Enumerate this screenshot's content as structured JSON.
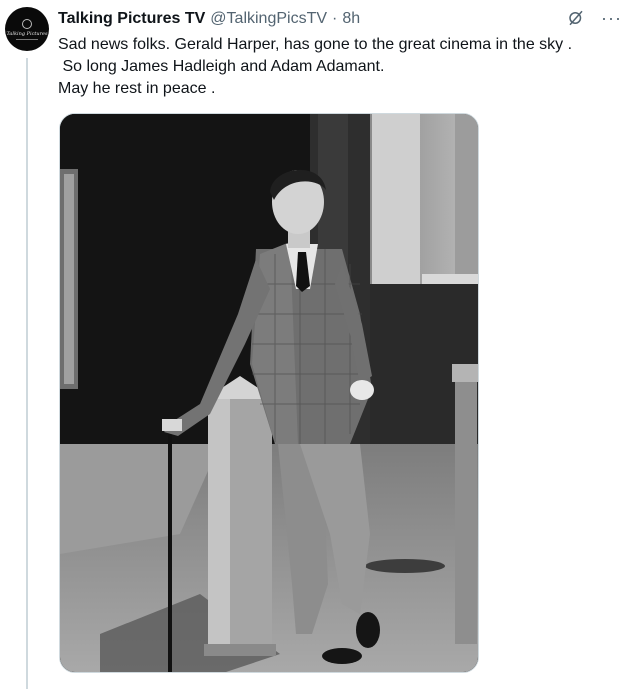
{
  "tweet": {
    "display_name": "Talking Pictures TV",
    "handle": "@TalkingPicsTV",
    "separator": "·",
    "time": "8h",
    "text_lines": [
      "Sad news folks. Gerald Harper, has gone to the great cinema in the sky .",
      " So long James Hadleigh and Adam Adamant.",
      "May he rest in peace ."
    ],
    "more_label": "···"
  },
  "avatar": {
    "logo_text": "Talking Pictures"
  },
  "media": {
    "description_icon": "photo"
  },
  "colors": {
    "text": "#0f1419",
    "secondary": "#536471",
    "border": "#cfd9de"
  }
}
